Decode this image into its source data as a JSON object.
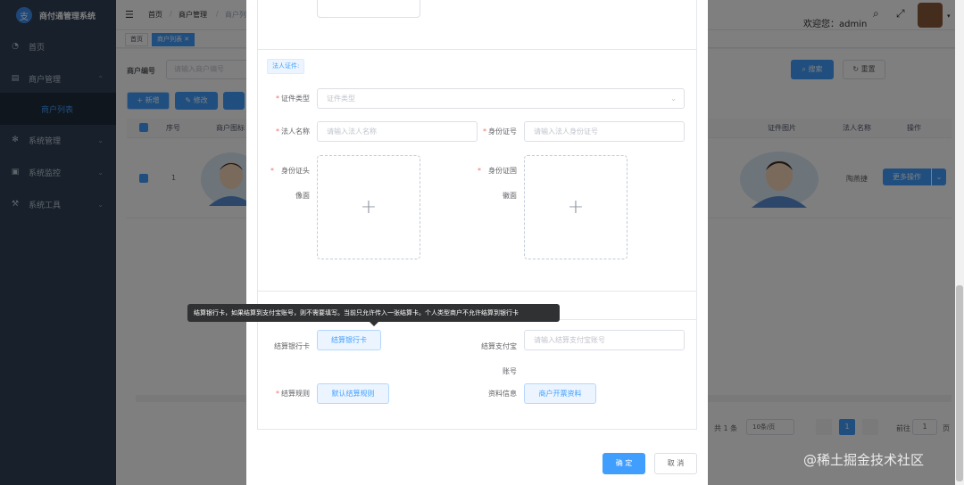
{
  "app": {
    "title": "商付通管理系统"
  },
  "sidebar": {
    "items": [
      {
        "label": "首页"
      },
      {
        "label": "商户管理"
      },
      {
        "label": "商户列表"
      },
      {
        "label": "系统管理"
      },
      {
        "label": "系统监控"
      },
      {
        "label": "系统工具"
      }
    ]
  },
  "header": {
    "breadcrumb": [
      "首页",
      "商户管理",
      "商户列"
    ],
    "welcome": "欢迎您：admin"
  },
  "tags": {
    "home": "首页",
    "active": "商户列表"
  },
  "page": {
    "search_label": "商户编号",
    "search_placeholder": "请输入商户编号",
    "search_button": "搜索",
    "reset_button": "重置",
    "add_button": "新增",
    "edit_button": "修改",
    "columns": {
      "index": "序号",
      "merchant_icon": "商户图标",
      "cert_image": "证件图片",
      "legal_name": "法人名称",
      "actions": "操作"
    },
    "row": {
      "index": "1",
      "legal_name": "陶燕捷",
      "more_button": "更多操作"
    },
    "pagination": {
      "total": "共 1 条",
      "page_size": "10条/页",
      "current_page": "1",
      "goto_label": "前往",
      "goto_value": "1",
      "page_suffix": "页"
    }
  },
  "dialog": {
    "section_legal": "法人证件:",
    "cert_type_label": "证件类型",
    "cert_type_placeholder": "证件类型",
    "legal_name_label": "法人名称",
    "legal_name_placeholder": "请输入法人名称",
    "id_number_label": "身份证号",
    "id_number_placeholder": "请输入法人身份证号",
    "id_front_label": "身份证头像面",
    "id_back_label": "身份证国徽面",
    "upload_plus": "+",
    "tooltip": "结算银行卡，如果结算到支付宝账号，则不需要填写。当前只允许传入一张结算卡。个人类型商户不允许结算到银行卡",
    "bank_card_label": "结算银行卡",
    "bank_card_button": "结算银行卡",
    "alipay_label": "结算支付宝账号",
    "alipay_placeholder": "请输入结算支付宝账号",
    "settle_rule_label": "结算规则",
    "settle_rule_button": "默认结算规则",
    "info_label": "资料信息",
    "info_button": "商户开票资料",
    "confirm_button": "确 定",
    "cancel_button": "取 消"
  },
  "watermark": "@稀土掘金技术社区",
  "colors": {
    "primary": "#409eff",
    "sidebar": "#304156",
    "required": "#f56c6c"
  }
}
